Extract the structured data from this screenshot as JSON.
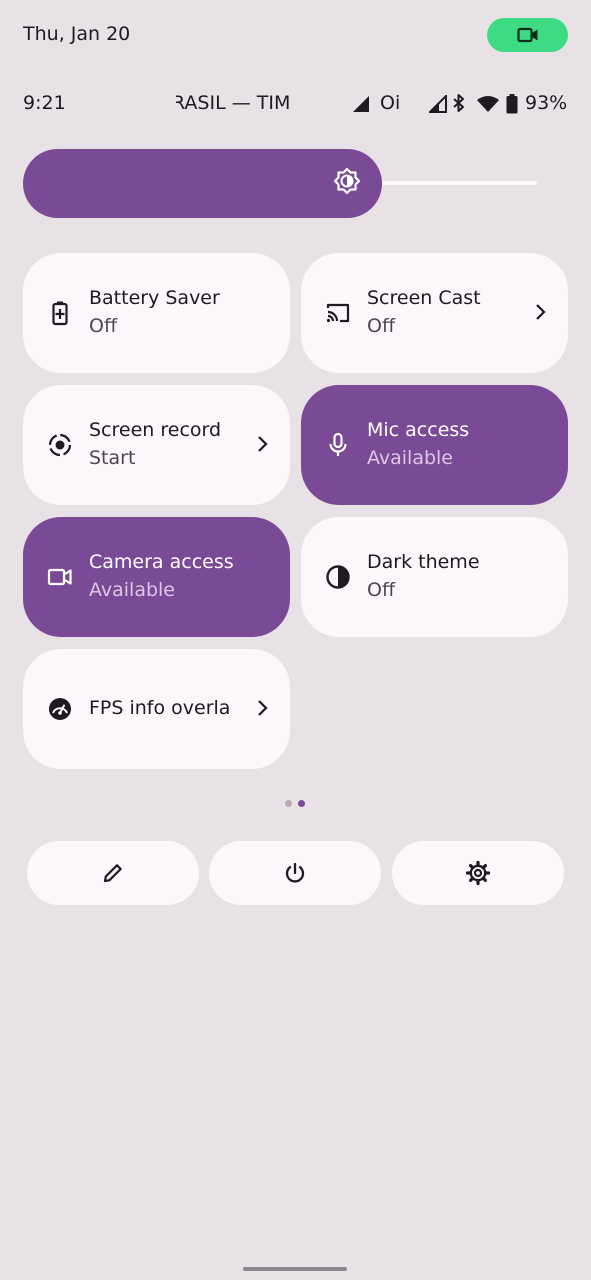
{
  "header": {
    "date": "Thu, Jan 20",
    "privacy_indicator_icon": "videocam-icon",
    "privacy_indicator_color": "#3ddc84"
  },
  "status_bar": {
    "time": "9:21",
    "carrier_text": "RASIL — TIM",
    "second_operator": "Oi",
    "battery_percent": "93%"
  },
  "brightness": {
    "level": 0.7,
    "icon": "brightness-auto-icon",
    "accent": "#7b4a96"
  },
  "tiles": [
    {
      "title": "Battery Saver",
      "subtitle": "Off",
      "icon": "battery-saver-icon",
      "active": false,
      "has_chevron": false
    },
    {
      "title": "Screen Cast",
      "subtitle": "Off",
      "icon": "cast-icon",
      "active": false,
      "has_chevron": true
    },
    {
      "title": "Screen record",
      "subtitle": "Start",
      "icon": "screen-record-icon",
      "active": false,
      "has_chevron": true
    },
    {
      "title": "Mic access",
      "subtitle": "Available",
      "icon": "mic-icon",
      "active": true,
      "has_chevron": false
    },
    {
      "title": "Camera access",
      "subtitle": "Available",
      "icon": "camera-icon",
      "active": true,
      "has_chevron": false
    },
    {
      "title": "Dark theme",
      "subtitle": "Off",
      "icon": "dark-theme-icon",
      "active": false,
      "has_chevron": false
    },
    {
      "title": "FPS info overlay",
      "subtitle": "",
      "icon": "fps-gauge-icon",
      "active": false,
      "has_chevron": true
    }
  ],
  "pager": {
    "pages": 2,
    "current": 2
  },
  "actions": [
    {
      "name": "edit",
      "icon": "pencil-icon"
    },
    {
      "name": "power",
      "icon": "power-icon"
    },
    {
      "name": "settings",
      "icon": "gear-icon"
    }
  ]
}
